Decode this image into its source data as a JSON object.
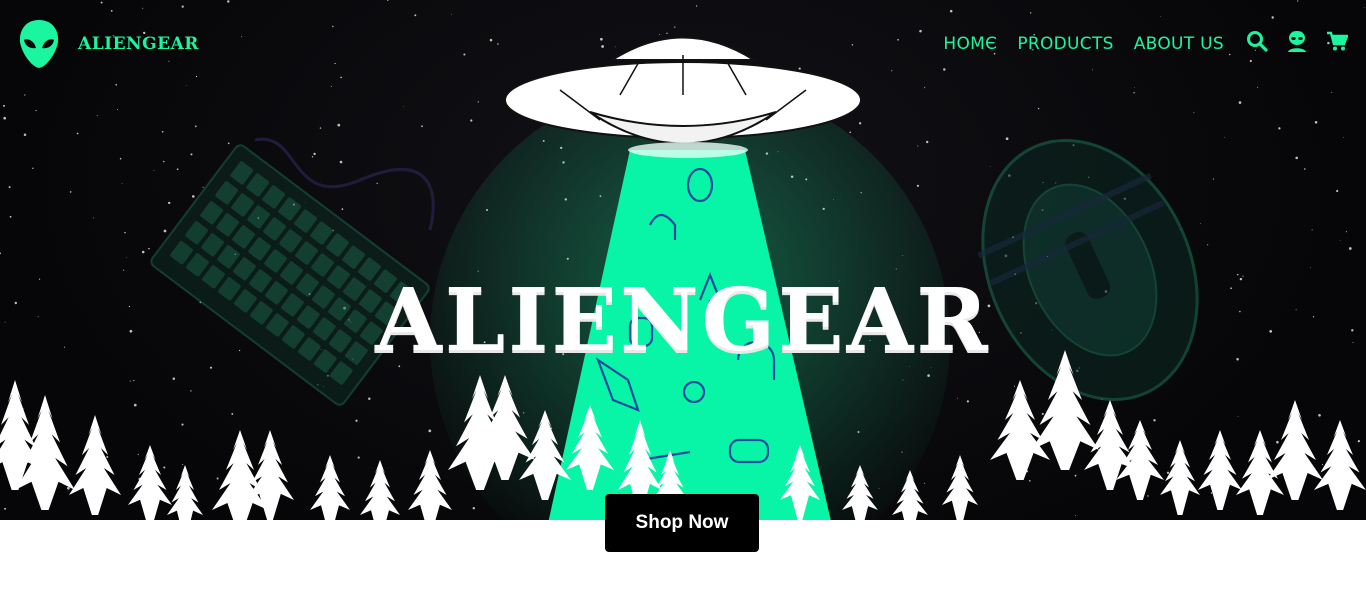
{
  "brand": {
    "name": "ALIENGEAR",
    "icon": "alien-head-icon"
  },
  "nav": {
    "items": [
      {
        "label": "HOMЄ"
      },
      {
        "label": "PRODUCTS"
      },
      {
        "label": "ABOUT US"
      }
    ],
    "icons": [
      "search-icon",
      "alien-account-icon",
      "cart-icon"
    ]
  },
  "hero": {
    "title": "ALIENGEAR",
    "cta_label": "Shop Now"
  },
  "colors": {
    "accent": "#1cf5a0",
    "background": "#07070a",
    "button": "#000000",
    "snow": "#ffffff"
  }
}
